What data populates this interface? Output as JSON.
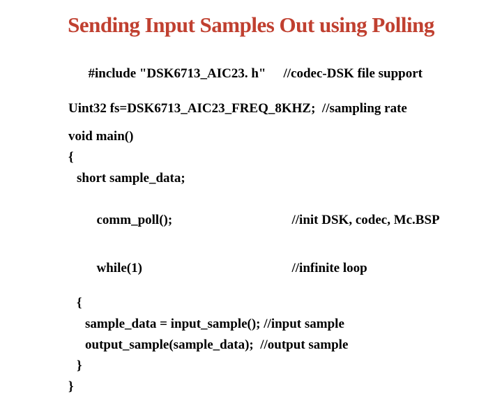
{
  "title": "Sending Input Samples Out using Polling",
  "code": {
    "l1a": "#include \"DSK6713_AIC23. h\"",
    "l1b": "//codec-DSK file support",
    "l2": "Uint32 fs=DSK6713_AIC23_FREQ_8KHZ;  //sampling rate",
    "l3": "void main()",
    "l4": "{",
    "l5": "short sample_data;",
    "l6a": "comm_poll();",
    "l6b": "//init DSK, codec, Mc.BSP",
    "l7a": "while(1)",
    "l7b": "//infinite loop",
    "l8": "{",
    "l9": "sample_data = input_sample(); //input sample",
    "l10": "output_sample(sample_data);  //output sample",
    "l11": "}",
    "l12": "}"
  }
}
